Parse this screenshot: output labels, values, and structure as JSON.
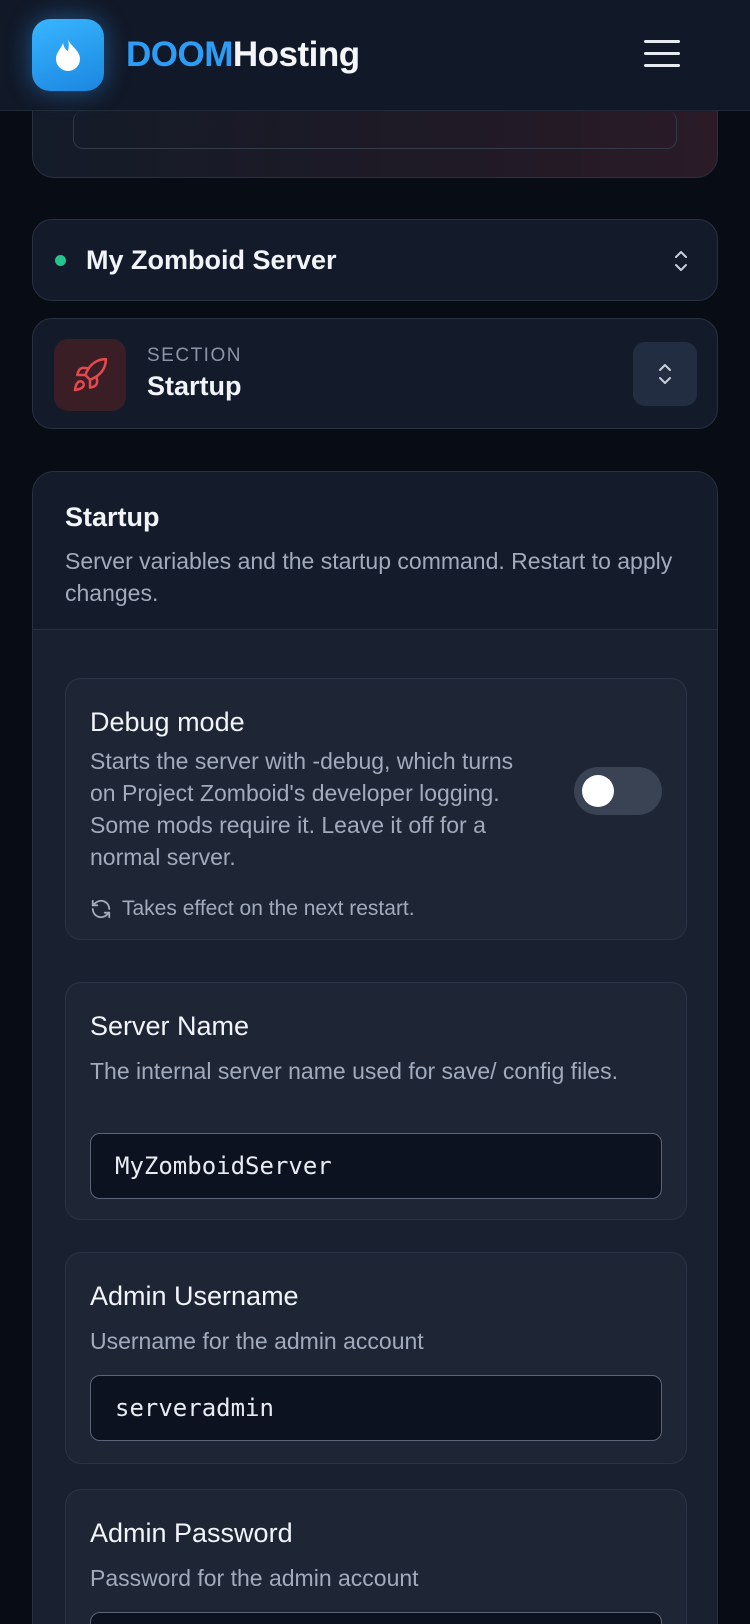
{
  "header": {
    "brand_prefix": "DOOM",
    "brand_suffix": "Hosting",
    "logo_icon": "flame-icon",
    "menu_icon": "hamburger-icon",
    "accent_color": "#2d9cf5"
  },
  "server_selector": {
    "name": "My Zomboid Server",
    "status_color": "#22c58a"
  },
  "section_selector": {
    "caption": "SECTION",
    "title": "Startup",
    "icon": "rocket-icon"
  },
  "panel": {
    "title": "Startup",
    "description": "Server variables and the startup command. Restart to apply changes.",
    "debug": {
      "title": "Debug mode",
      "description": "Starts the server with -debug, which turns on Project Zomboid's developer logging. Some mods require it. Leave it off for a normal server.",
      "enabled": false,
      "note": "Takes effect on the next restart."
    },
    "fields": [
      {
        "title": "Server Name",
        "description": "The internal server name used for save/ config files.",
        "value": "MyZomboidServer"
      },
      {
        "title": "Admin Username",
        "description": "Username for the admin account",
        "value": "serveradmin"
      },
      {
        "title": "Admin Password",
        "description": "Password for the admin account",
        "value": ""
      }
    ]
  }
}
